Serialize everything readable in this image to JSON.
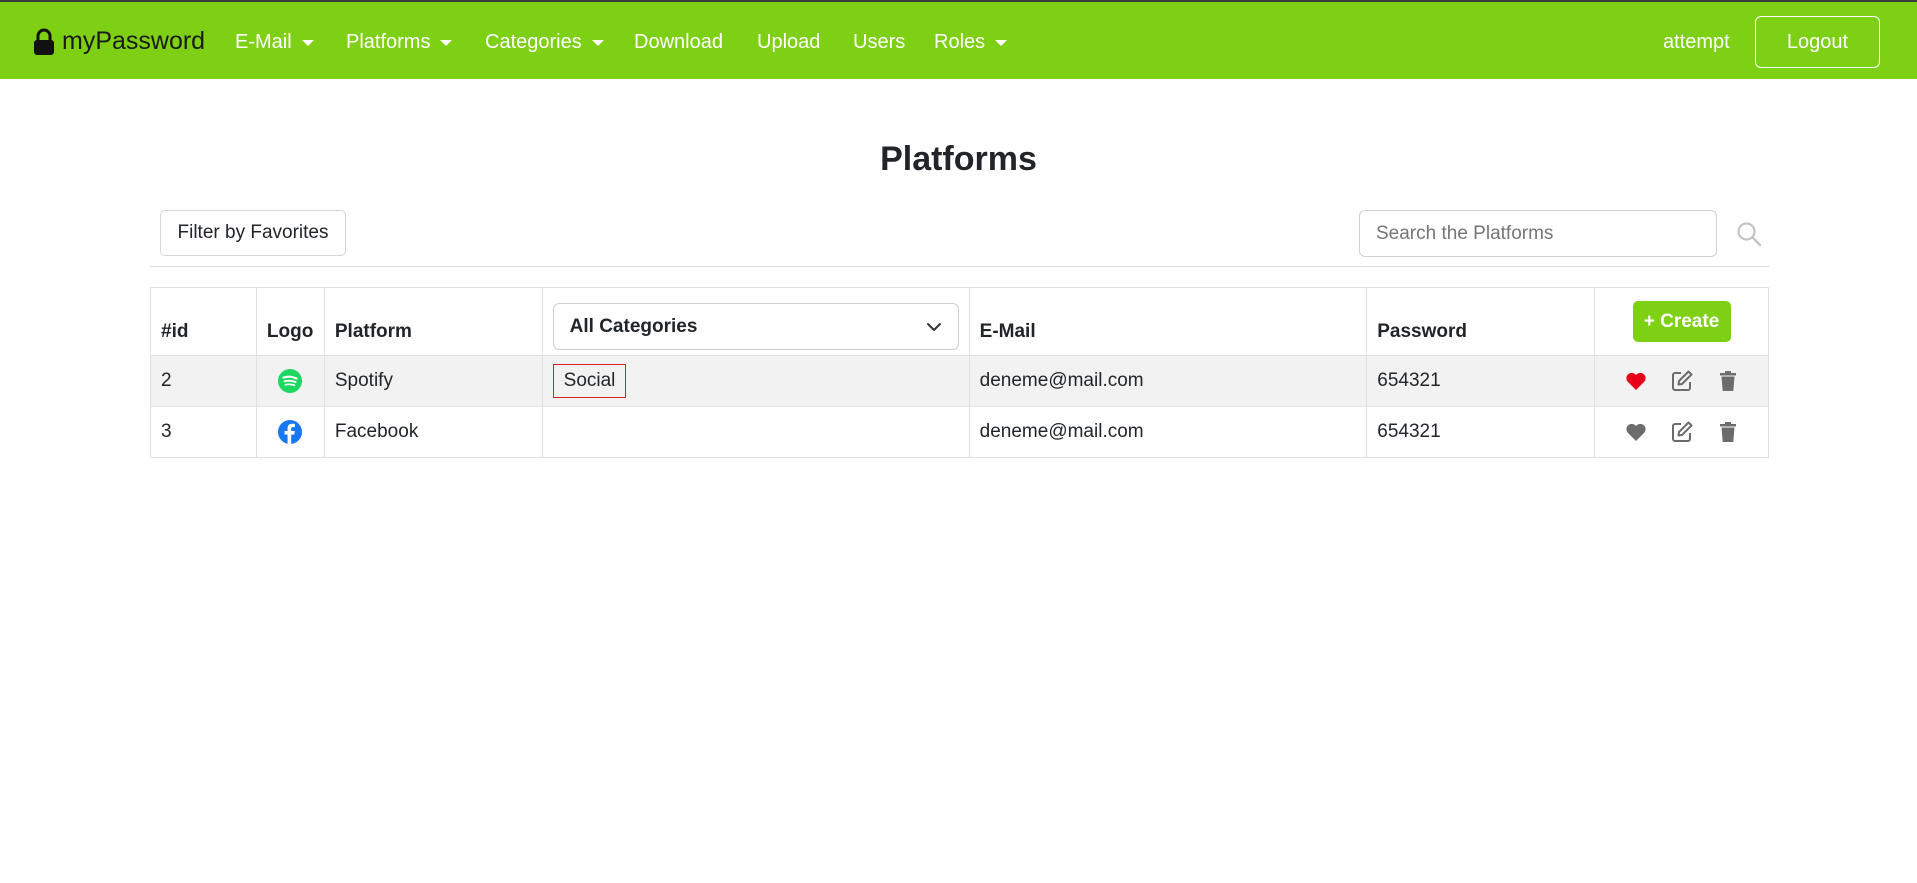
{
  "navbar": {
    "brand": "myPassword",
    "items": [
      {
        "label": "E-Mail",
        "dropdown": true
      },
      {
        "label": "Platforms",
        "dropdown": true
      },
      {
        "label": "Categories",
        "dropdown": true
      },
      {
        "label": "Download",
        "dropdown": false
      },
      {
        "label": "Upload",
        "dropdown": false
      },
      {
        "label": "Users",
        "dropdown": false
      },
      {
        "label": "Roles",
        "dropdown": true
      }
    ],
    "user": "attempt",
    "logout_label": "Logout"
  },
  "page": {
    "title": "Platforms",
    "filter_label": "Filter by Favorites",
    "search_placeholder": "Search the Platforms"
  },
  "table": {
    "headers": {
      "id": "#id",
      "logo": "Logo",
      "platform": "Platform",
      "category_select": "All Categories",
      "email": "E-Mail",
      "password": "Password",
      "create": "+ Create"
    },
    "rows": [
      {
        "id": "2",
        "logo_icon": "spotify-icon",
        "platform": "Spotify",
        "category": "Social",
        "email": "deneme@mail.com",
        "password": "654321",
        "favorite": true
      },
      {
        "id": "3",
        "logo_icon": "facebook-icon",
        "platform": "Facebook",
        "category": "",
        "email": "deneme@mail.com",
        "password": "654321",
        "favorite": false
      }
    ]
  },
  "colors": {
    "brand_green": "#7ed014",
    "favorite_red": "#e8001a",
    "icon_gray": "#6c6c6c",
    "spotify_green": "#1ed760",
    "facebook_blue": "#1877f2"
  }
}
